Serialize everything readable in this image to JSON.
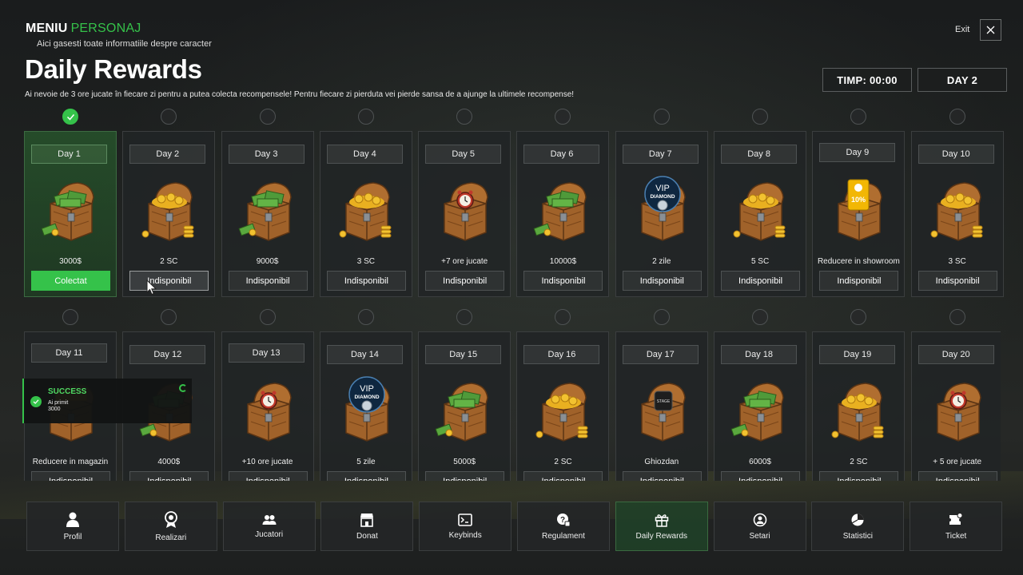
{
  "header": {
    "menu_title": "MENIU",
    "menu_title_accent": "PERSONAJ",
    "menu_subtitle": "Aici gasesti toate informatiile despre caracter",
    "page_title": "Daily Rewards",
    "description": "Ai nevoie de 3 ore jucate în fiecare zi pentru a putea colecta recompensele! Pentru fiecare zi pierduta vei pierde sansa de a ajunge la ultimele recompense!",
    "exit_label": "Exit",
    "timer": "TIMP: 00:00",
    "current_day": "DAY 2"
  },
  "rewards": [
    {
      "day": "Day 1",
      "reward": "3000$",
      "button": "Colectat",
      "icon": "cash-chest-icon",
      "claimed": true
    },
    {
      "day": "Day 2",
      "reward": "2 SC",
      "button": "Indisponibil",
      "icon": "gold-chest-icon"
    },
    {
      "day": "Day 3",
      "reward": "9000$",
      "button": "Indisponibil",
      "icon": "cash-chest-icon"
    },
    {
      "day": "Day 4",
      "reward": "3 SC",
      "button": "Indisponibil",
      "icon": "gold-chest-icon"
    },
    {
      "day": "Day 5",
      "reward": "+7 ore jucate",
      "button": "Indisponibil",
      "icon": "clock-chest-icon"
    },
    {
      "day": "Day 6",
      "reward": "10000$",
      "button": "Indisponibil",
      "icon": "cash-chest-icon"
    },
    {
      "day": "Day 7",
      "reward": "2 zile",
      "button": "Indisponibil",
      "icon": "vip-diamond-chest-icon"
    },
    {
      "day": "Day 8",
      "reward": "5 SC",
      "button": "Indisponibil",
      "icon": "gold-chest-icon"
    },
    {
      "day": "Day 9",
      "reward": "Reducere in showroom",
      "button": "Indisponibil",
      "icon": "discount-ticket-chest-icon"
    },
    {
      "day": "Day 10",
      "reward": "3 SC",
      "button": "Indisponibil",
      "icon": "gold-chest-icon"
    },
    {
      "day": "Day 11",
      "reward": "Reducere in magazin",
      "button": "Indisponibil",
      "icon": "discount-chest-icon"
    },
    {
      "day": "Day 12",
      "reward": "4000$",
      "button": "Indisponibil",
      "icon": "cash-chest-icon"
    },
    {
      "day": "Day 13",
      "reward": "+10 ore jucate",
      "button": "Indisponibil",
      "icon": "clock-chest-icon"
    },
    {
      "day": "Day 14",
      "reward": "5 zile",
      "button": "Indisponibil",
      "icon": "vip-diamond-chest-icon"
    },
    {
      "day": "Day 15",
      "reward": "5000$",
      "button": "Indisponibil",
      "icon": "cash-chest-icon"
    },
    {
      "day": "Day 16",
      "reward": "2 SC",
      "button": "Indisponibil",
      "icon": "gold-chest-icon"
    },
    {
      "day": "Day 17",
      "reward": "Ghiozdan",
      "button": "Indisponibil",
      "icon": "backpack-chest-icon"
    },
    {
      "day": "Day 18",
      "reward": "6000$",
      "button": "Indisponibil",
      "icon": "cash-chest-icon"
    },
    {
      "day": "Day 19",
      "reward": "2 SC",
      "button": "Indisponibil",
      "icon": "gold-chest-icon"
    },
    {
      "day": "Day 20",
      "reward": "+ 5 ore jucate",
      "button": "Indisponibil",
      "icon": "clock-chest-icon"
    }
  ],
  "vip_badge": {
    "line1": "VIP",
    "line2": "DIAMOND"
  },
  "discount_badge": "10%",
  "backpack_label": "STAGE",
  "toast": {
    "title": "SUCCESS",
    "line1": "Ai primit",
    "line2": "3000"
  },
  "nav": [
    {
      "label": "Profil",
      "icon": "user-icon"
    },
    {
      "label": "Realizari",
      "icon": "award-icon"
    },
    {
      "label": "Jucatori",
      "icon": "users-icon"
    },
    {
      "label": "Donat",
      "icon": "shop-icon"
    },
    {
      "label": "Keybinds",
      "icon": "terminal-icon"
    },
    {
      "label": "Regulament",
      "icon": "rules-icon"
    },
    {
      "label": "Daily Rewards",
      "icon": "gift-icon",
      "active": true
    },
    {
      "label": "Setari",
      "icon": "settings-user-icon"
    },
    {
      "label": "Statistici",
      "icon": "pie-chart-icon"
    },
    {
      "label": "Ticket",
      "icon": "ticket-icon"
    }
  ],
  "colors": {
    "accent": "#35c24a",
    "background": "#17191a",
    "card": "#212425",
    "gold": "#e9b020",
    "wood": "#9a5b27",
    "cash": "#4f9a3a"
  }
}
